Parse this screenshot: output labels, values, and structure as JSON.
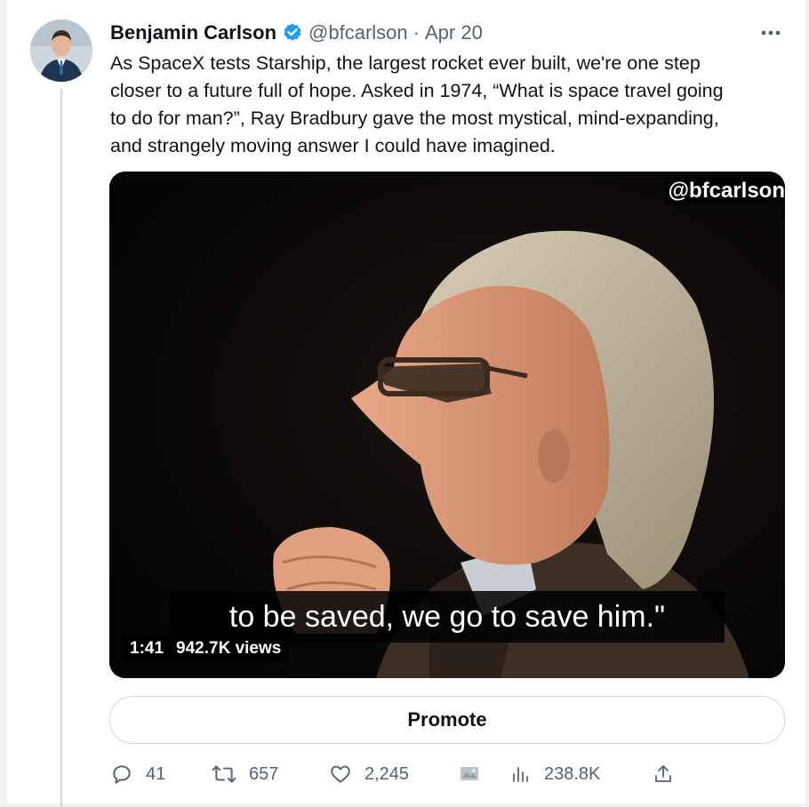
{
  "tweet": {
    "author_name": "Benjamin Carlson",
    "handle": "@bfcarlson",
    "separator": "·",
    "date": "Apr 20",
    "text_lines": [
      "As SpaceX tests Starship, the largest rocket ever built, we're one step",
      "closer to a future full of hope. Asked in 1974, “What is space travel going",
      "to do for man?”, Ray Bradbury gave the most mystical, mind-expanding,",
      "and strangely moving answer I could have imagined."
    ]
  },
  "media": {
    "watermark": "@bfcarlson",
    "subtitle": "to be saved, we go to save him.\"",
    "duration": "1:41",
    "views": "942.7K views"
  },
  "promote_label": "Promote",
  "actions": {
    "replies": "41",
    "retweets": "657",
    "likes": "2,245",
    "analytics_views": "238.8K"
  },
  "colors": {
    "verified_blue": "#1d9bf0",
    "secondary_text": "#536471",
    "border": "#cfd9de"
  },
  "icons": [
    "more-icon",
    "verified-icon",
    "reply-icon",
    "retweet-icon",
    "like-icon",
    "media-studio-icon",
    "views-icon",
    "share-icon"
  ]
}
